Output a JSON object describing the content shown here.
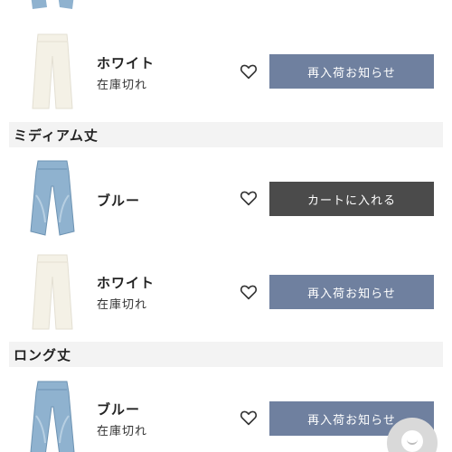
{
  "colors": {
    "notify_button": "#6f809f",
    "cart_button": "#4b4b4b",
    "section_header_bg": "#f3f3f3",
    "blue_denim": "#8fb2cf",
    "white_denim": "#f4f1e6"
  },
  "sections": [
    {
      "title": "ミディアム丈"
    },
    {
      "title": "ロング丈"
    }
  ],
  "items": [
    {
      "color_name": "ホワイト",
      "stock_status": "在庫切れ",
      "button_label": "再入荷お知らせ",
      "button_type": "notify",
      "image": "white-jeans"
    },
    {
      "color_name": "ブルー",
      "stock_status": "",
      "button_label": "カートに入れる",
      "button_type": "cart",
      "image": "blue-jeans"
    },
    {
      "color_name": "ホワイト",
      "stock_status": "在庫切れ",
      "button_label": "再入荷お知らせ",
      "button_type": "notify",
      "image": "white-jeans"
    },
    {
      "color_name": "ブルー",
      "stock_status": "在庫切れ",
      "button_label": "再入荷お知らせ",
      "button_type": "notify",
      "image": "blue-jeans"
    }
  ],
  "icons": {
    "favorite": "heart-outline-icon",
    "chat": "chat-bubble-icon"
  }
}
